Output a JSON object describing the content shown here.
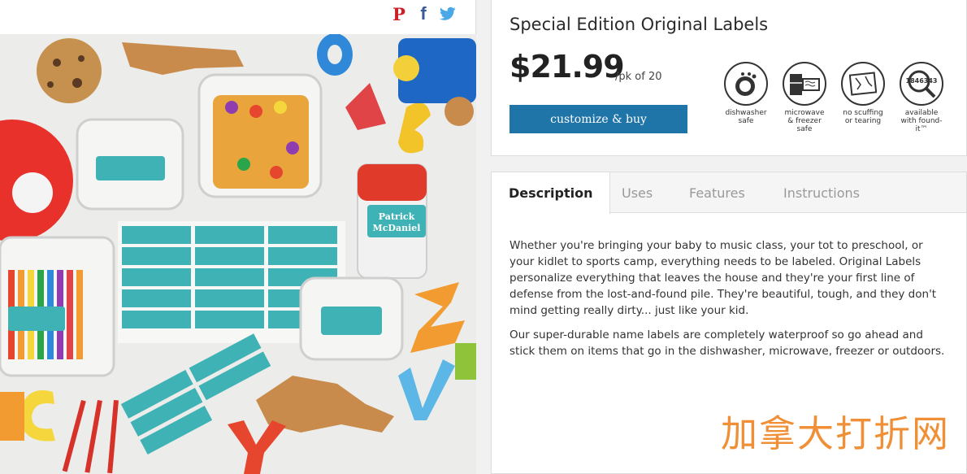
{
  "share": {
    "pinterest_icon": "pinterest-icon",
    "facebook_icon": "facebook-icon",
    "twitter_icon": "twitter-icon",
    "pinterest_glyph": "P",
    "facebook_glyph": "f"
  },
  "product": {
    "title": "Special Edition Original Labels",
    "price": "$21.99",
    "unit": "/pk of 20",
    "buy_label": "customize & buy",
    "image_labels": {
      "name_line1": "Patrick",
      "name_line2": "McDaniel"
    }
  },
  "features": [
    {
      "icon": "dishwasher-icon",
      "label": "dishwasher safe"
    },
    {
      "icon": "microwave-freezer-icon",
      "label": "microwave & freezer safe"
    },
    {
      "icon": "no-scuffing-icon",
      "label": "no scuffing or tearing"
    },
    {
      "icon": "found-it-icon",
      "label": "available with found-it™",
      "code": "1846343"
    }
  ],
  "tabs": [
    {
      "label": "Description",
      "active": true
    },
    {
      "label": "Uses",
      "active": false
    },
    {
      "label": "Features",
      "active": false
    },
    {
      "label": "Instructions",
      "active": false
    }
  ],
  "description": {
    "paragraphs": [
      "Whether you're bringing your baby to music class, your tot to preschool, or your kidlet to sports camp, everything needs to be labeled. Original Labels personalize everything that leaves the house and they're your first line of defense from the lost-and-found pile. They're beautiful, tough, and they don't mind getting really dirty... just like your kid.",
      "Our super-durable name labels are completely waterproof so go ahead and stick them on items that go in the dishwasher, microwave, freezer or outdoors."
    ]
  },
  "watermark": "加拿大打折网",
  "colors": {
    "button": "#1f74a8",
    "label_teal": "#3fb2b5",
    "watermark": "#f08a2c"
  }
}
